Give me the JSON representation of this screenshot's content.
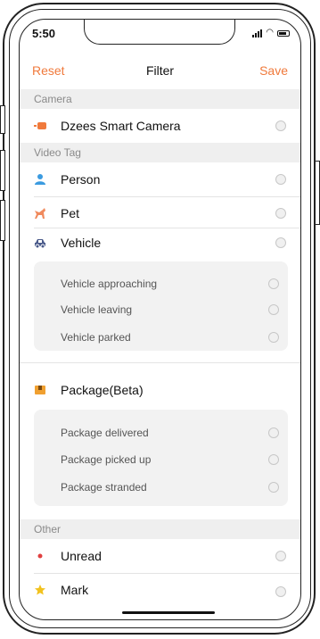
{
  "status": {
    "time": "5:50"
  },
  "nav": {
    "reset_label": "Reset",
    "title": "Filter",
    "save_label": "Save"
  },
  "sections": {
    "camera": {
      "header": "Camera",
      "items": [
        {
          "label": "Dzees Smart Camera",
          "icon": "camera-icon"
        }
      ]
    },
    "video_tag": {
      "header": "Video Tag",
      "person": "Person",
      "pet": "Pet",
      "vehicle": {
        "label": "Vehicle",
        "subitems": [
          "Vehicle approaching",
          "Vehicle leaving",
          "Vehicle parked"
        ]
      },
      "package": {
        "label": "Package(Beta)",
        "subitems": [
          "Package delivered",
          "Package picked up",
          "Package stranded"
        ]
      }
    },
    "other": {
      "header": "Other",
      "unread": "Unread",
      "mark": "Mark"
    }
  },
  "colors": {
    "accent": "#f07a3c",
    "person_icon": "#3b9be0",
    "pet_icon": "#f08a5d",
    "vehicle_icon": "#4a5a8a",
    "package_icon": "#f0a030",
    "unread_dot": "#e04040",
    "mark_star": "#f2c21e"
  }
}
